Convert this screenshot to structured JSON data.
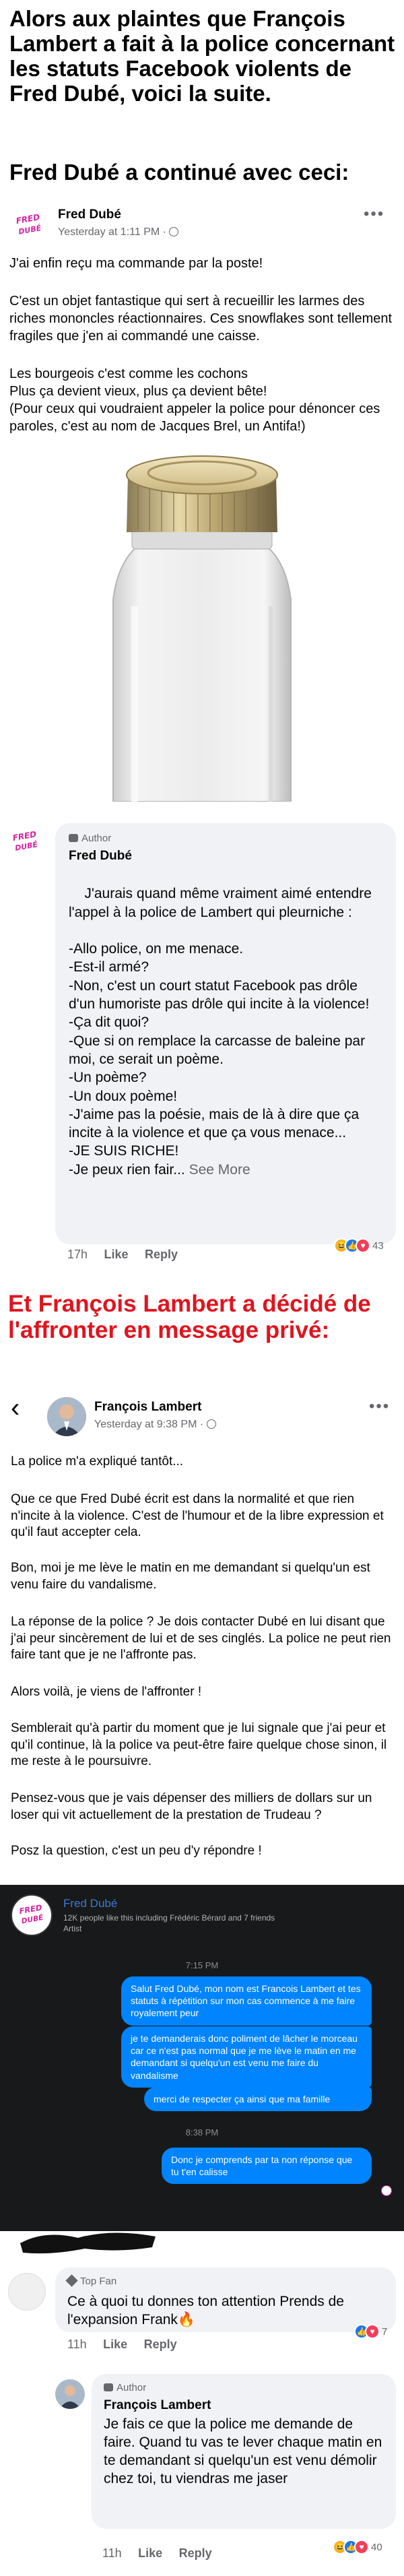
{
  "intro": {
    "headline": "Alors aux plaintes que François Lambert a fait à la police concernant les statuts Facebook violents de Fred Dubé, voici la suite.",
    "subheadline": "Fred Dubé a continué avec ceci:"
  },
  "post1": {
    "author": "Fred Dubé",
    "meta": "Yesterday at 1:11 PM ·",
    "more": "•••",
    "p1": "J'ai enfin reçu ma commande par la poste!",
    "p2": "C'est un objet fantastique qui sert à recueillir les larmes des riches mononcles réactionnaires. Ces snowflakes sont tellement fragiles que j'en ai commandé une caisse.",
    "p3": "Les bourgeois c'est comme les cochons\nPlus ça devient vieux, plus ça devient bête!\n(Pour ceux qui voudraient appeler la police pour dénoncer ces paroles, c'est au nom de Jacques Brel, un Antifa!)"
  },
  "comment1": {
    "badge": "Author",
    "author": "Fred Dubé",
    "text": "J'aurais quand même vraiment aimé entendre l'appel à la police de Lambert qui pleurniche :\n\n-Allo police, on me menace.\n-Est-il armé?\n-Non, c'est un court statut Facebook pas drôle d'un humoriste pas drôle qui incite à la violence!\n-Ça dit quoi?\n-Que si on remplace la carcasse de baleine par moi, ce serait un poème.\n-Un poème?\n-Un doux poème!\n-J'aime pas la poésie, mais de là à dire que ça incite à la violence et que ça vous menace...\n-JE SUIS RICHE!\n-Je peux rien fair...",
    "see_more": "See More",
    "time": "17h",
    "like": "Like",
    "reply": "Reply",
    "reactions_count": "43"
  },
  "section2": {
    "headline": "Et François Lambert a décidé de l'affronter en message privé:"
  },
  "post2": {
    "back": "‹",
    "author": "François Lambert",
    "meta": "Yesterday at 9:38 PM ·",
    "p1": "La police m'a expliqué tantôt...",
    "p2": "Que ce que Fred Dubé écrit est dans la normalité et que rien n'incite à la violence. C'est de l'humour et de la libre expression et qu'il faut accepter cela.",
    "p3": "Bon, moi je me lève le matin en me demandant si quelqu'un est venu faire du vandalisme.",
    "p4": "La réponse de la police ? Je dois contacter Dubé en lui disant que j'ai peur sincèrement de lui et de ses cinglés. La police ne peut rien faire tant que je ne l'affronte pas.",
    "p5": "Alors voilà, je viens de l'affronter !",
    "p6": "Semblerait qu'à partir du moment que je lui signale que j'ai peur et qu'il continue, là la police va peut-être faire quelque chose sinon, il me reste à le poursuivre.",
    "p7": "Pensez-vous que je vais dépenser des milliers de dollars sur un loser qui vit actuellement de la prestation de Trudeau ?",
    "p8": "Posz la question, c'est un peu d'y répondre !"
  },
  "messenger": {
    "name": "Fred Dubé",
    "likes": "12K people like this including Frédéric Bérard and 7 friends",
    "category": "Artist",
    "time1": "7:15 PM",
    "msg1": "Salut Fred Dubé, mon nom est Francois Lambert et tes statuts à répétition sur mon cas commence à me faire royalement peur",
    "msg2": "je te demanderais donc poliment de lâcher le morceau car ce n'est pas normal que je me lève le matin en me demandant si quelqu'un est venu me faire du vandalisme",
    "msg3": "merci de respecter ça ainsi que ma famille",
    "time2": "8:38 PM",
    "msg4": "Donc je comprends par ta non réponse que tu t'en calisse"
  },
  "comment2": {
    "badge": "Top Fan",
    "text": "Ce à quoi tu donnes ton attention Prends de l'expansion Frank🔥",
    "time": "11h",
    "like": "Like",
    "reply": "Reply",
    "reactions_count": "7"
  },
  "comment3": {
    "badge": "Author",
    "author": "François Lambert",
    "text": "Je fais ce que la police me demande de faire. Quand tu vas te lever chaque matin en te demandant si quelqu'un est venu démolir chez toi, tu viendras me jaser",
    "time": "11h",
    "like": "Like",
    "reply": "Reply",
    "reactions_count": "40"
  },
  "colors": {
    "fb_blue": "#1877f2",
    "messenger_blue": "#0084ff",
    "headline_red": "#e0141e",
    "gray_text": "#65676b",
    "bubble_gray": "#f0f2f5",
    "dark_bg": "#18191a",
    "like_blue": "#1877f2",
    "love_red": "#f33e58",
    "haha_yellow": "#f7b125"
  },
  "icons": [
    "globe-icon",
    "more-icon",
    "back-icon",
    "author-badge-icon",
    "top-fan-icon",
    "like-reaction-icon",
    "love-reaction-icon",
    "haha-reaction-icon",
    "jar-image",
    "avatar"
  ]
}
